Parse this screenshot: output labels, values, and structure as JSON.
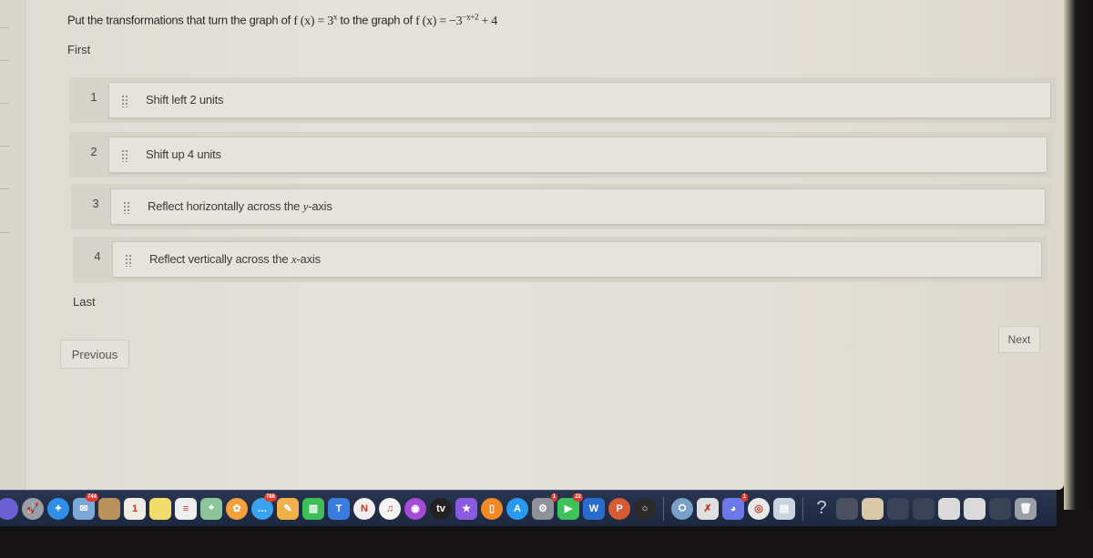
{
  "question": {
    "prefix": "Put the transformations that turn the graph of",
    "f1": "f (x) = 3",
    "f1_exp": "x",
    "middle": "to the graph of",
    "f2": "f (x) = −3",
    "f2_exp": "−x+2",
    "f2_suffix": "+ 4"
  },
  "labels": {
    "first": "First",
    "last": "Last"
  },
  "ordering": {
    "items": [
      {
        "number": "1",
        "text": "Shift left 2 units"
      },
      {
        "number": "2",
        "text": "Shift up 4 units"
      },
      {
        "number": "3",
        "text_pre": "Reflect horizontally across the ",
        "var": "y",
        "text_post": "-axis"
      },
      {
        "number": "4",
        "text_pre": "Reflect vertically across the ",
        "var": "x",
        "text_post": "-axis"
      }
    ]
  },
  "buttons": {
    "previous": "Previous",
    "next": "Next"
  },
  "pin_icon": "✎",
  "dock": {
    "items": [
      {
        "name": "siri",
        "glyph": "",
        "color": "#6b5fd6",
        "round": true
      },
      {
        "name": "launchpad",
        "glyph": "🚀",
        "color": "#9a9ea6",
        "round": true
      },
      {
        "name": "safari",
        "glyph": "✦",
        "color": "#2e8ee8",
        "round": true
      },
      {
        "name": "mail",
        "glyph": "✉",
        "color": "#7aa8d8",
        "badge": "744"
      },
      {
        "name": "contacts",
        "glyph": "",
        "color": "#b8925a"
      },
      {
        "name": "calendar",
        "glyph": "1",
        "color": "#f0ece4"
      },
      {
        "name": "notes",
        "glyph": "",
        "color": "#f2dc6a"
      },
      {
        "name": "reminders",
        "glyph": "≡",
        "color": "#eeeeee"
      },
      {
        "name": "maps",
        "glyph": "⌖",
        "color": "#8cc59a"
      },
      {
        "name": "photos",
        "glyph": "✿",
        "color": "#f2a13c",
        "round": true
      },
      {
        "name": "messages",
        "glyph": "…",
        "color": "#3aa4f0",
        "round": true,
        "badge": "786"
      },
      {
        "name": "pages",
        "glyph": "✎",
        "color": "#f0b04a"
      },
      {
        "name": "numbers",
        "glyph": "▥",
        "color": "#3fbf5a"
      },
      {
        "name": "keynote",
        "glyph": "T",
        "color": "#3a7be0"
      },
      {
        "name": "news",
        "glyph": "N",
        "color": "#f0eeee",
        "round": true
      },
      {
        "name": "music",
        "glyph": "♫",
        "color": "#f5f5f5",
        "round": true
      },
      {
        "name": "podcasts",
        "glyph": "◉",
        "color": "#a64bd8",
        "round": true
      },
      {
        "name": "apple-tv",
        "glyph": "tv",
        "color": "#222222",
        "round": true
      },
      {
        "name": "imovie",
        "glyph": "★",
        "color": "#8a5ae0"
      },
      {
        "name": "books",
        "glyph": "▯",
        "color": "#f08a24",
        "round": true
      },
      {
        "name": "app-store",
        "glyph": "A",
        "color": "#2a9af0",
        "round": true
      },
      {
        "name": "system-preferences",
        "glyph": "⚙",
        "color": "#8e9298",
        "badge": "1"
      },
      {
        "name": "facetime",
        "glyph": "▶",
        "color": "#3ec35a",
        "badge": "22"
      },
      {
        "name": "word",
        "glyph": "W",
        "color": "#2b6bd0"
      },
      {
        "name": "powerpoint",
        "glyph": "P",
        "color": "#d65a32",
        "round": true
      },
      {
        "name": "camera",
        "glyph": "○",
        "color": "#2a2a2a",
        "round": true
      },
      {
        "sep": true
      },
      {
        "name": "disk-utility",
        "glyph": "⛭",
        "color": "#7aa0c8",
        "round": true
      },
      {
        "name": "xcode-tools",
        "glyph": "✗",
        "color": "#e0e0e0"
      },
      {
        "name": "discord",
        "glyph": "◕",
        "color": "#6a78e8",
        "badge": "1"
      },
      {
        "name": "chrome",
        "glyph": "◎",
        "color": "#e8e8e8",
        "round": true
      },
      {
        "name": "preview",
        "glyph": "▤",
        "color": "#c8d4e0"
      },
      {
        "sep": true
      },
      {
        "name": "help",
        "glyph": "?",
        "color": "transparent"
      },
      {
        "name": "window-1",
        "glyph": "",
        "color": "#4a5060"
      },
      {
        "name": "window-2",
        "glyph": "",
        "color": "#d8c8a8"
      },
      {
        "name": "window-3",
        "glyph": "",
        "color": "#3a4258"
      },
      {
        "name": "window-4",
        "glyph": "",
        "color": "#3a4258"
      },
      {
        "name": "window-5",
        "glyph": "",
        "color": "#dadada"
      },
      {
        "name": "window-6",
        "glyph": "",
        "color": "#dadada"
      },
      {
        "name": "window-7",
        "glyph": "",
        "color": "#3a4258"
      },
      {
        "name": "trash",
        "glyph": "🗑",
        "color": "#9a9ea6"
      }
    ]
  }
}
